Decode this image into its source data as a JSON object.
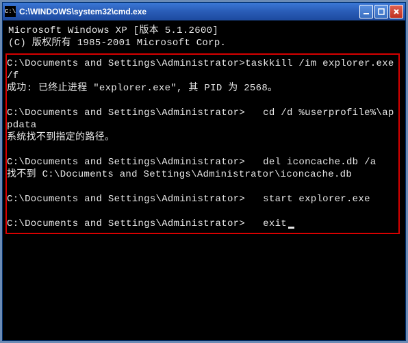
{
  "titlebar": {
    "icon_label": "C:\\",
    "title": "C:\\WINDOWS\\system32\\cmd.exe"
  },
  "controls": {
    "minimize": "minimize",
    "maximize": "maximize",
    "close": "close"
  },
  "header": {
    "line1": "Microsoft Windows XP [版本 5.1.2600]",
    "line2": "(C) 版权所有 1985-2001 Microsoft Corp."
  },
  "commands": [
    {
      "prompt": "C:\\Documents and Settings\\Administrator>",
      "cmd": "taskkill /im explorer.exe /f",
      "output": "成功: 已终止进程 \"explorer.exe\", 其 PID 为 2568。"
    },
    {
      "prompt": "C:\\Documents and Settings\\Administrator>",
      "cmd": "   cd /d %userprofile%\\appdata",
      "output": "系统找不到指定的路径。"
    },
    {
      "prompt": "C:\\Documents and Settings\\Administrator>",
      "cmd": "   del iconcache.db /a",
      "output": "找不到 C:\\Documents and Settings\\Administrator\\iconcache.db"
    },
    {
      "prompt": "C:\\Documents and Settings\\Administrator>",
      "cmd": "   start explorer.exe",
      "output": ""
    },
    {
      "prompt": "C:\\Documents and Settings\\Administrator>",
      "cmd": "   exit",
      "output": ""
    }
  ]
}
